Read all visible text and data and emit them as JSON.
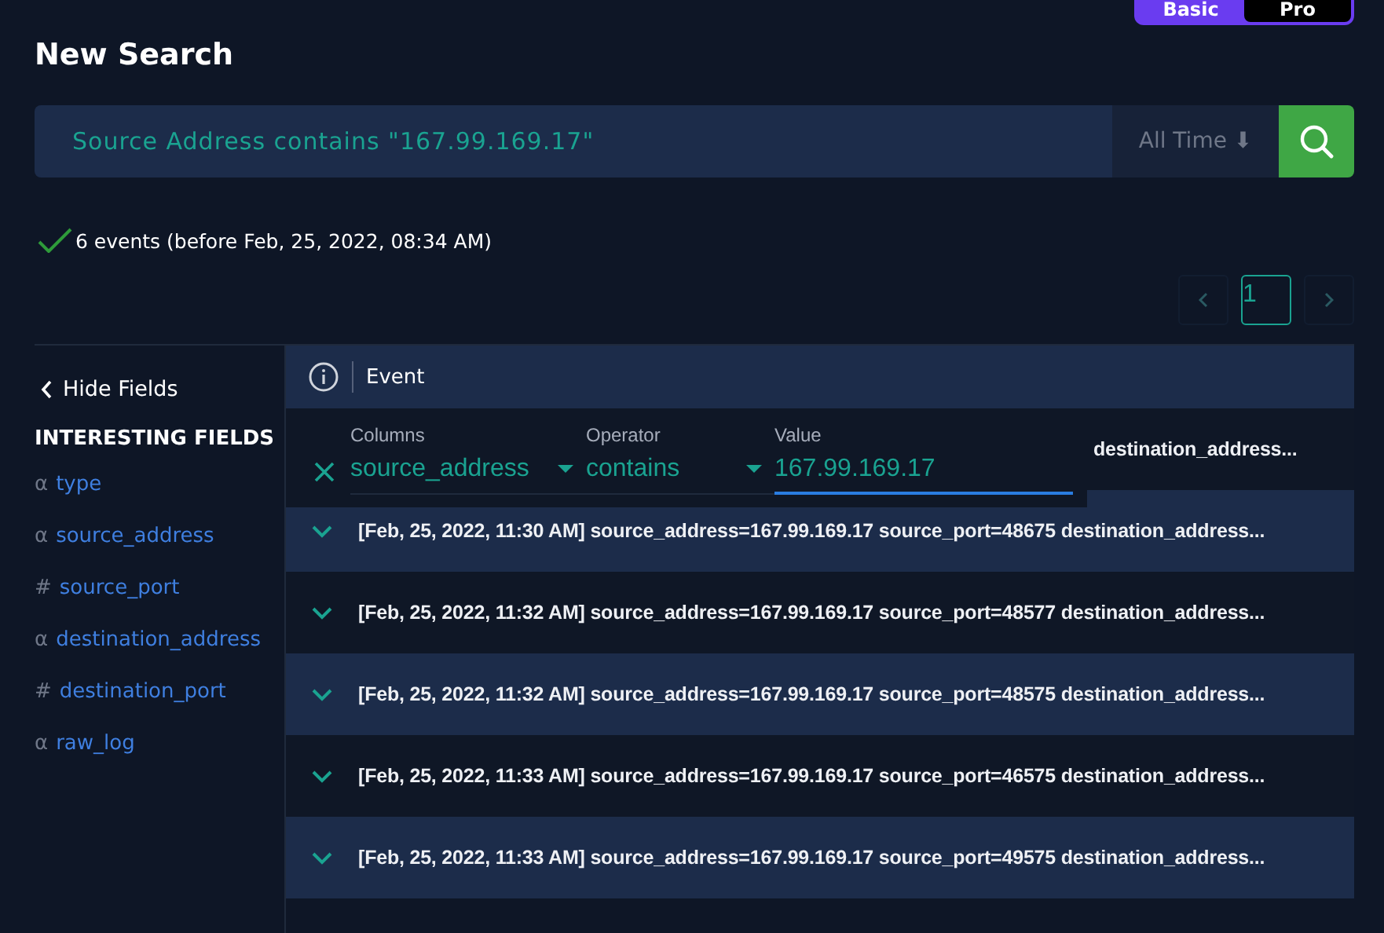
{
  "mode_toggle": [
    {
      "label": "Basic",
      "selected": true
    },
    {
      "label": "Pro",
      "selected": false
    }
  ],
  "title": "New Search",
  "search": {
    "value": "Source Address contains \"167.99.169.17\"",
    "time_range": "All Time ⬇"
  },
  "status": "6 events (before Feb, 25, 2022, 08:34 AM)",
  "pagination": {
    "pages": [
      {
        "label": "1",
        "selected": true
      }
    ]
  },
  "sidebar": {
    "toggle": "Hide Fields",
    "heading": "INTERESTING FIELDS",
    "fields": [
      {
        "type_symbol": "α",
        "name": "type"
      },
      {
        "type_symbol": "α",
        "name": "source_address"
      },
      {
        "type_symbol": "#",
        "name": "source_port"
      },
      {
        "type_symbol": "α",
        "name": "destination_address"
      },
      {
        "type_symbol": "#",
        "name": "destination_port"
      },
      {
        "type_symbol": "α",
        "name": "raw_log"
      }
    ]
  },
  "table": {
    "column": "Event",
    "rows": [
      {
        "kind": "covered",
        "text": "destination_address..."
      },
      {
        "kind": "full",
        "text": "[Feb, 25, 2022, 11:30 AM] source_address=167.99.169.17 source_port=48675 destination_address..."
      },
      {
        "kind": "full",
        "text": "[Feb, 25, 2022, 11:32 AM] source_address=167.99.169.17 source_port=48577 destination_address..."
      },
      {
        "kind": "full",
        "text": "[Feb, 25, 2022, 11:32 AM] source_address=167.99.169.17 source_port=48575 destination_address..."
      },
      {
        "kind": "full",
        "text": "[Feb, 25, 2022, 11:33 AM] source_address=167.99.169.17 source_port=46575 destination_address..."
      },
      {
        "kind": "full",
        "text": "[Feb, 25, 2022, 11:33 AM] source_address=167.99.169.17 source_port=49575 destination_address..."
      }
    ]
  },
  "filter_popup": {
    "columns_label": "Columns",
    "column_value": "source_address",
    "operator_label": "Operator",
    "operator_value": "contains",
    "value_label": "Value",
    "value": "167.99.169.17"
  }
}
